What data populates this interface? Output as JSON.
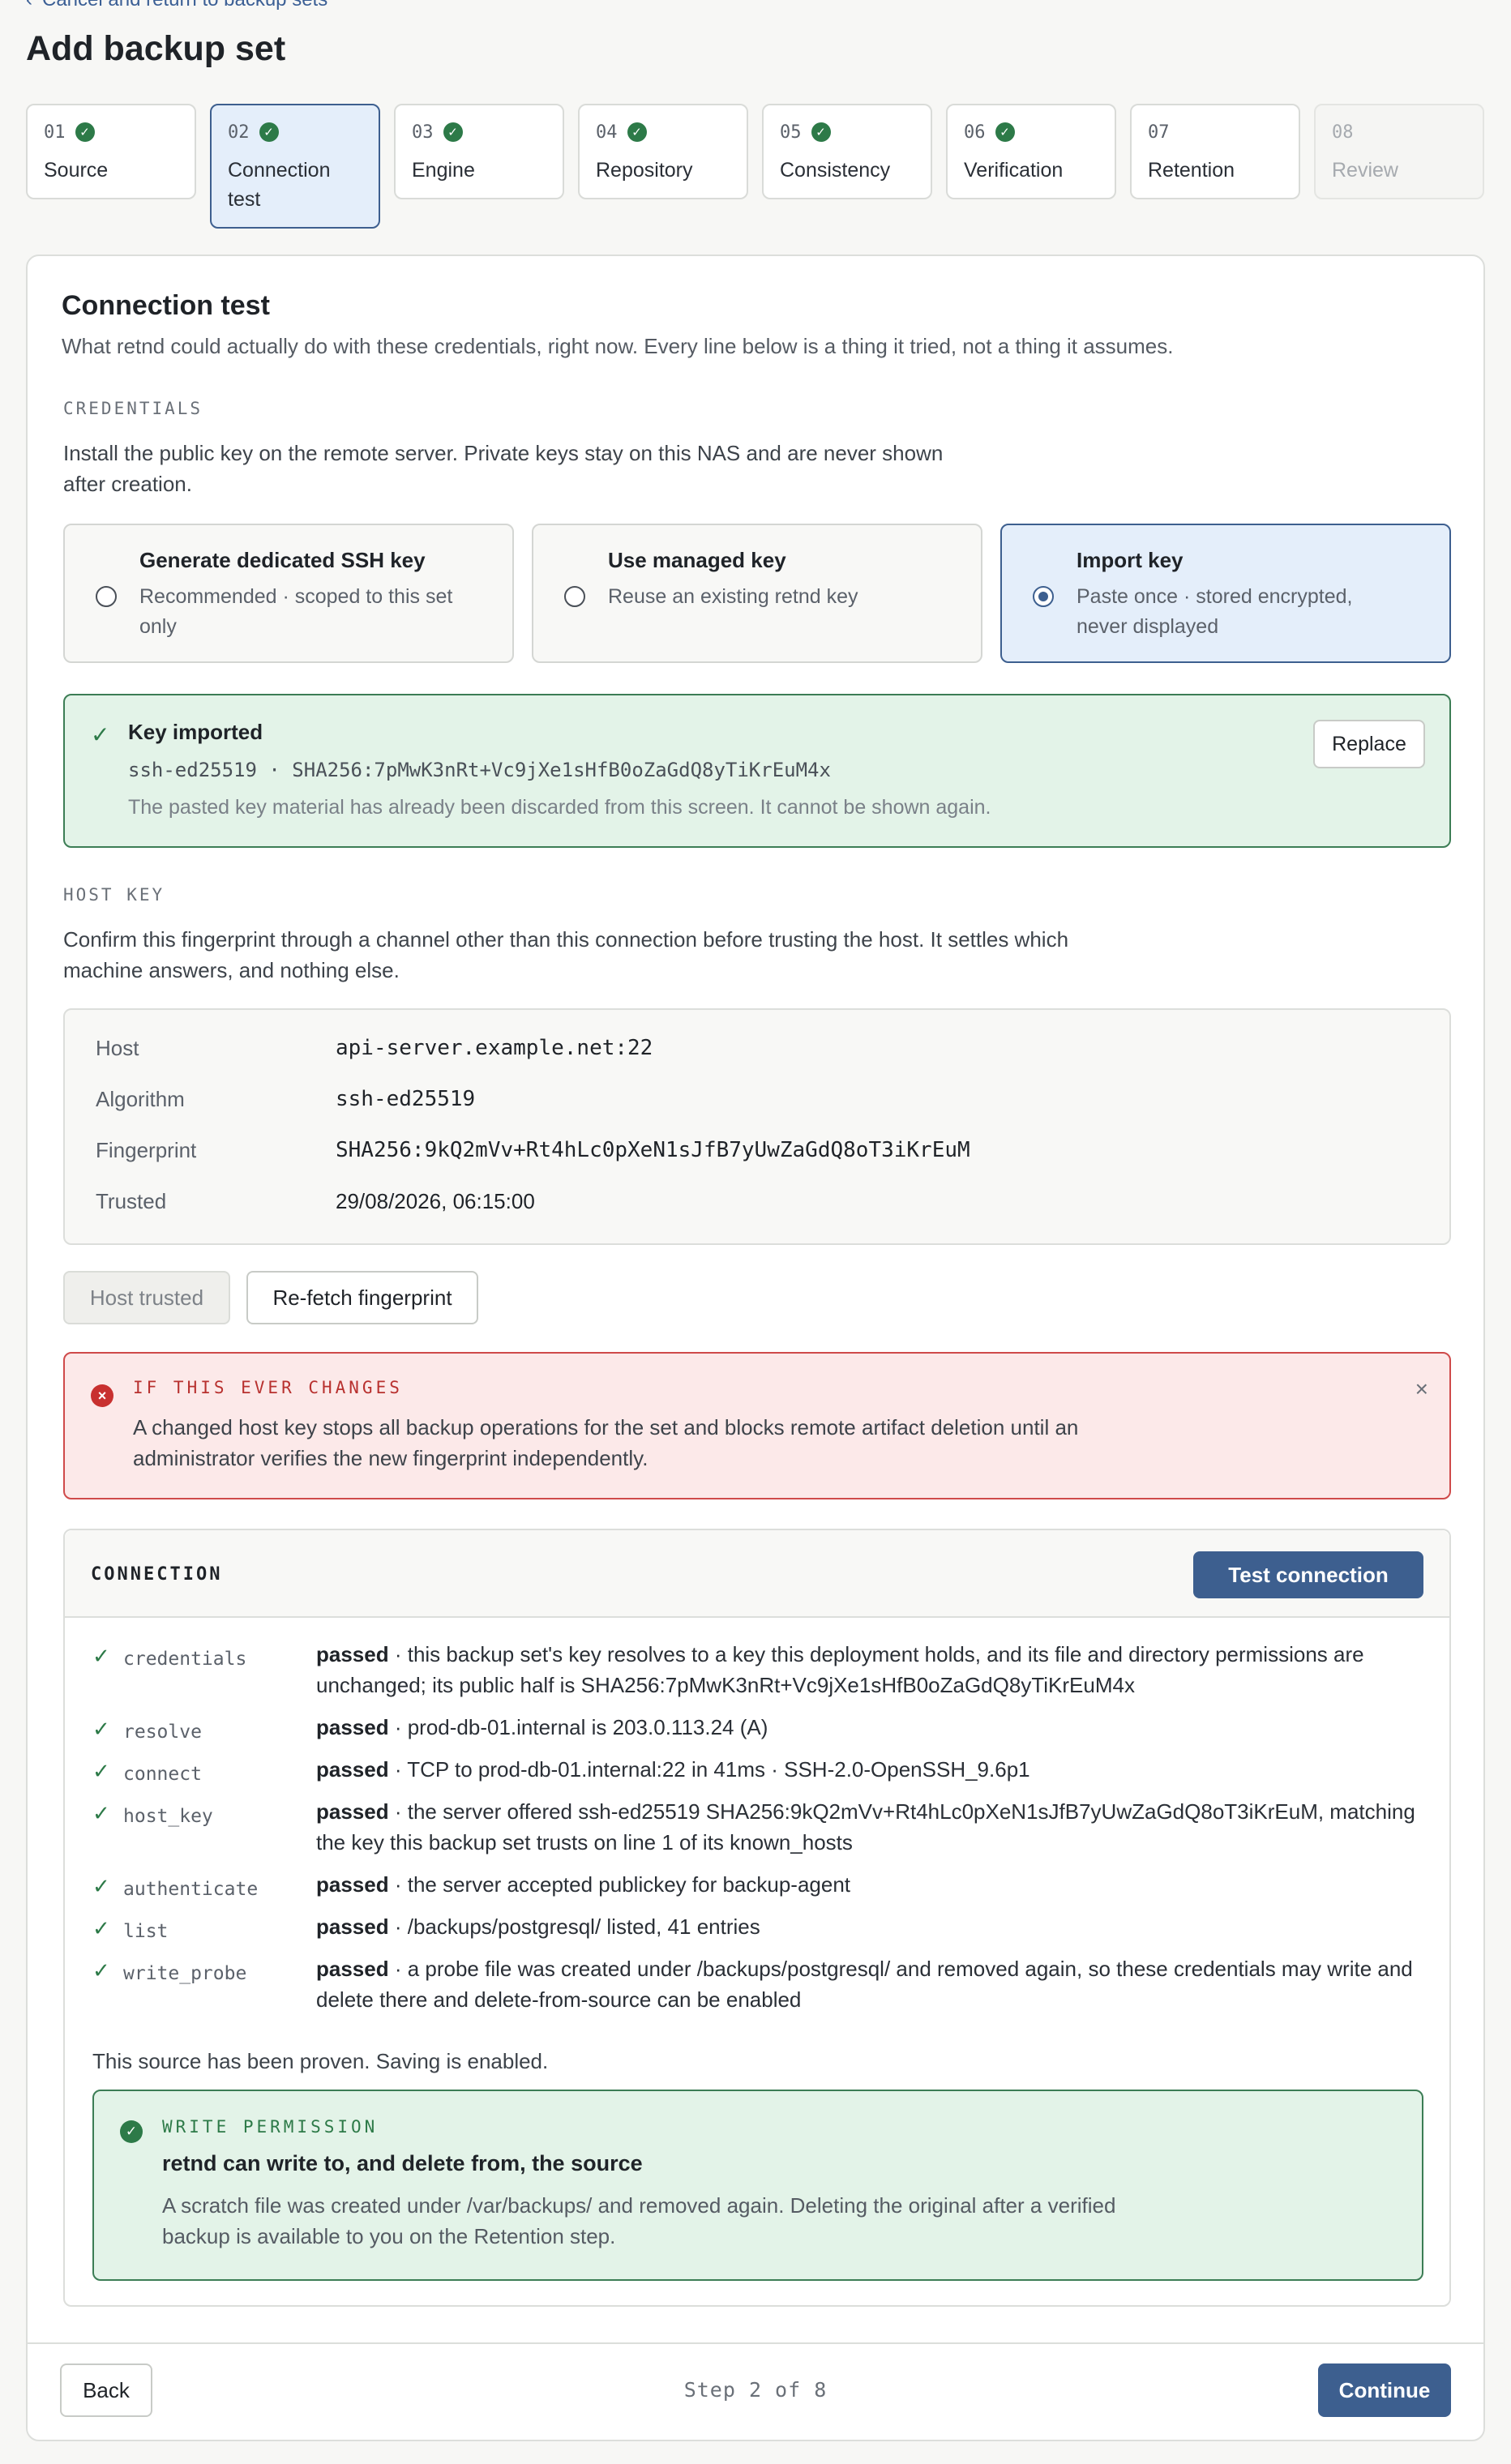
{
  "nav": {
    "back_link": "Cancel and return to backup sets"
  },
  "page": {
    "title": "Add backup set"
  },
  "steps": [
    {
      "num": "01",
      "label": "Source",
      "state": "done"
    },
    {
      "num": "02",
      "label": "Connection test",
      "state": "current-done"
    },
    {
      "num": "03",
      "label": "Engine",
      "state": "done"
    },
    {
      "num": "04",
      "label": "Repository",
      "state": "done"
    },
    {
      "num": "05",
      "label": "Consistency",
      "state": "done"
    },
    {
      "num": "06",
      "label": "Verification",
      "state": "done"
    },
    {
      "num": "07",
      "label": "Retention",
      "state": "pending"
    },
    {
      "num": "08",
      "label": "Review",
      "state": "disabled"
    }
  ],
  "connection_test": {
    "title": "Connection test",
    "intro": "What retnd could actually do with these credentials, right now. Every line below is a thing it tried, not a thing it assumes."
  },
  "credentials": {
    "label": "CREDENTIALS",
    "help": "Install the public key on the remote server. Private keys stay on this NAS and are never shown after creation.",
    "options": [
      {
        "title": "Generate dedicated SSH key",
        "desc": "Recommended · scoped to this set only",
        "selected": false
      },
      {
        "title": "Use managed key",
        "desc": "Reuse an existing retnd key",
        "selected": false
      },
      {
        "title": "Import key",
        "desc": "Paste once · stored encrypted, never displayed",
        "selected": true
      }
    ],
    "imported": {
      "title": "Key imported",
      "fingerprint": "ssh-ed25519 · SHA256:7pMwK3nRt+Vc9jXe1sHfB0oZaGdQ8yTiKrEuM4x",
      "note": "The pasted key material has already been discarded from this screen. It cannot be shown again.",
      "replace_label": "Replace"
    }
  },
  "host_key": {
    "label": "HOST KEY",
    "help": "Confirm this fingerprint through a channel other than this connection before trusting the host. It settles which machine answers, and nothing else.",
    "rows": [
      {
        "label": "Host",
        "value": "api-server.example.net:22"
      },
      {
        "label": "Algorithm",
        "value": "ssh-ed25519"
      },
      {
        "label": "Fingerprint",
        "value": "SHA256:9kQ2mVv+Rt4hLc0pXeN1sJfB7yUwZaGdQ8oT3iKrEuM"
      },
      {
        "label": "Trusted",
        "value": "29/08/2026, 06:15:00"
      }
    ],
    "trusted_label": "Host trusted",
    "refetch_label": "Re-fetch fingerprint"
  },
  "alert": {
    "title": "IF THIS EVER CHANGES",
    "body": "A changed host key stops all backup operations for the set and blocks remote artifact deletion until an administrator verifies the new fingerprint independently.",
    "close": "×"
  },
  "connection": {
    "title": "CONNECTION",
    "test_label": "Test connection",
    "checks": [
      {
        "name": "credentials",
        "status": "passed",
        "text": " · this backup set's key resolves to a key this deployment holds, and its file and directory permissions are unchanged; its public half is SHA256:7pMwK3nRt+Vc9jXe1sHfB0oZaGdQ8yTiKrEuM4x"
      },
      {
        "name": "resolve",
        "status": "passed",
        "text": " · prod-db-01.internal is 203.0.113.24 (A)"
      },
      {
        "name": "connect",
        "status": "passed",
        "text": " · TCP to prod-db-01.internal:22 in 41ms · SSH-2.0-OpenSSH_9.6p1"
      },
      {
        "name": "host_key",
        "status": "passed",
        "text": " · the server offered ssh-ed25519 SHA256:9kQ2mVv+Rt4hLc0pXeN1sJfB7yUwZaGdQ8oT3iKrEuM, matching the key this backup set trusts on line 1 of its known_hosts"
      },
      {
        "name": "authenticate",
        "status": "passed",
        "text": " · the server accepted publickey for backup-agent"
      },
      {
        "name": "list",
        "status": "passed",
        "text": " · /backups/postgresql/ listed, 41 entries"
      },
      {
        "name": "write_probe",
        "status": "passed",
        "text": " · a probe file was created under /backups/postgresql/ and removed again, so these credentials may write and delete there and delete-from-source can be enabled"
      }
    ],
    "proven": "This source has been proven. Saving is enabled.",
    "write_permission": {
      "label": "WRITE PERMISSION",
      "heading": "retnd can write to, and delete from, the source",
      "body": "A scratch file was created under /var/backups/ and removed again. Deleting the original after a verified backup is available to you on the Retention step."
    }
  },
  "footer": {
    "back_label": "Back",
    "step_count": "Step 2 of 8",
    "continue_label": "Continue"
  }
}
